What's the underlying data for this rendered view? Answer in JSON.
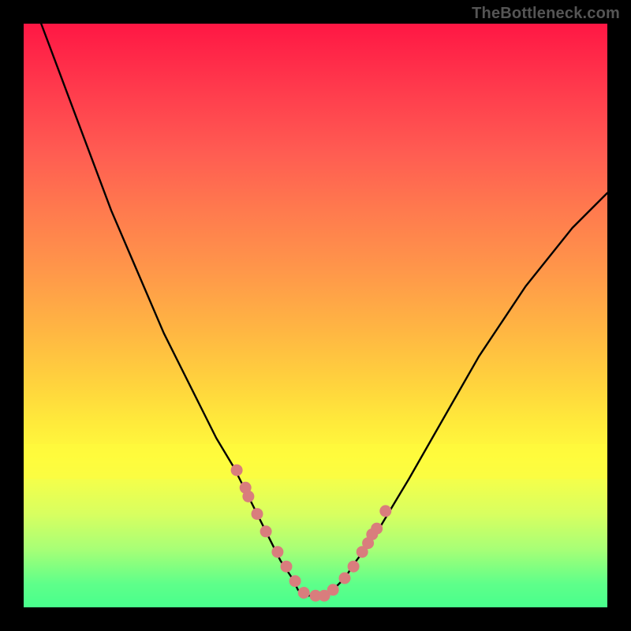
{
  "watermark": "TheBottleneck.com",
  "colors": {
    "gradient_top": "#ff1744",
    "gradient_bottom": "#2dff8f",
    "curve": "#000000",
    "marker": "#d97d7d",
    "band_yellow": "#fffb3c",
    "band_green": "#5eff8a"
  },
  "chart_data": {
    "type": "line",
    "title": "",
    "xlabel": "",
    "ylabel": "",
    "xlim": [
      0,
      100
    ],
    "ylim": [
      0,
      100
    ],
    "grid": false,
    "legend": false,
    "series": [
      {
        "name": "bottleneck-curve",
        "x": [
          0,
          3,
          6,
          9,
          12,
          15,
          18,
          21,
          24,
          27,
          30,
          33,
          36,
          38,
          40,
          42,
          44,
          46,
          47,
          48,
          50,
          52,
          53,
          55,
          57,
          60,
          63,
          66,
          70,
          74,
          78,
          82,
          86,
          90,
          94,
          98,
          100
        ],
        "y": [
          110,
          100,
          92,
          84,
          76,
          68,
          61,
          54,
          47,
          41,
          35,
          29,
          24,
          20,
          16,
          12,
          8,
          5,
          3,
          2,
          2,
          2,
          3,
          5,
          8,
          12,
          17,
          22,
          29,
          36,
          43,
          49,
          55,
          60,
          65,
          69,
          71
        ]
      }
    ],
    "markers": {
      "name": "highlight-dots",
      "x": [
        36.5,
        38.0,
        38.5,
        40.0,
        41.5,
        43.5,
        45.0,
        46.5,
        48.0,
        50.0,
        51.5,
        53.0,
        55.0,
        56.5,
        58.0,
        59.0,
        59.7,
        60.5,
        62.0
      ],
      "y": [
        23.5,
        20.5,
        19.0,
        16.0,
        13.0,
        9.5,
        7.0,
        4.5,
        2.5,
        2.0,
        2.0,
        3.0,
        5.0,
        7.0,
        9.5,
        11.0,
        12.5,
        13.5,
        16.5
      ],
      "r": 7.5
    },
    "bands": [
      {
        "name": "yellow-band",
        "y0": 72,
        "y1": 78,
        "color": "#fffb3c",
        "alpha": 0.55
      },
      {
        "name": "green-band",
        "y0": 96,
        "y1": 100,
        "color": "#5eff8a",
        "alpha": 0.55
      }
    ]
  }
}
